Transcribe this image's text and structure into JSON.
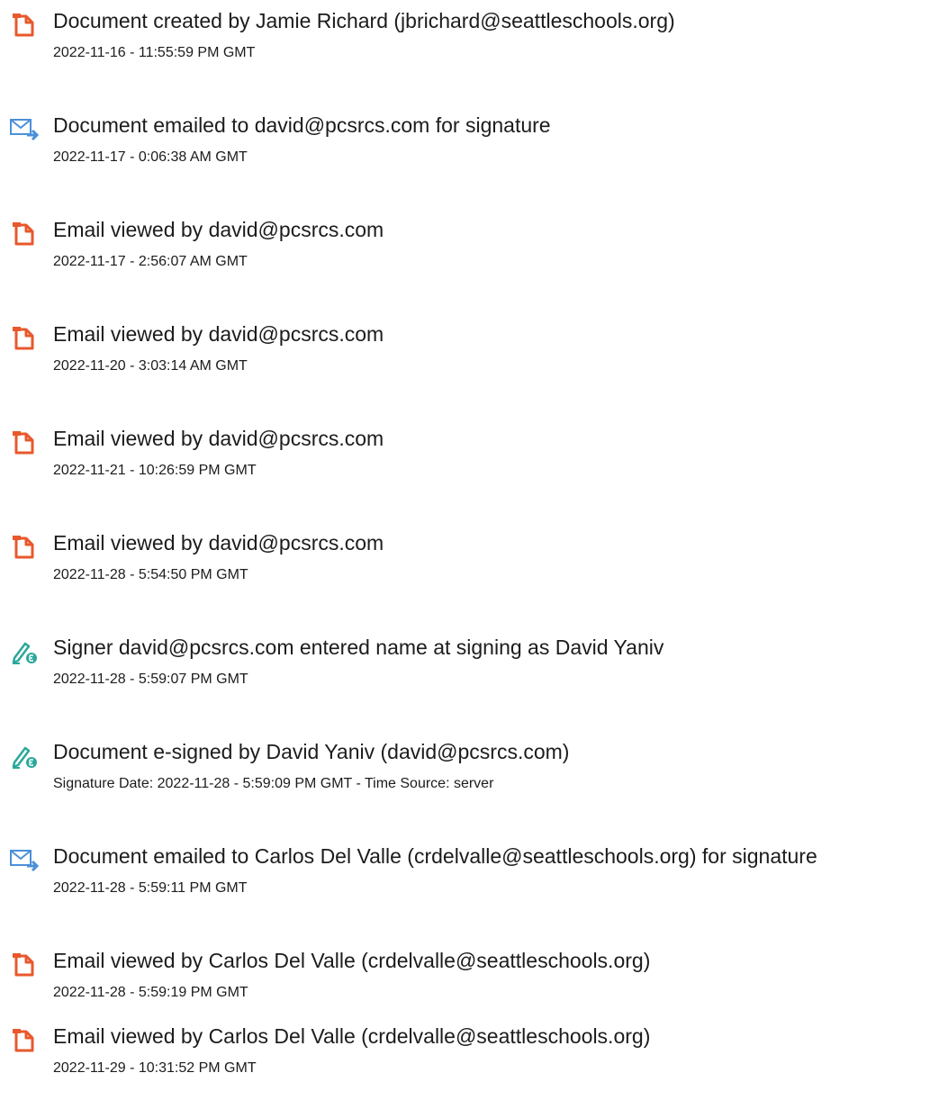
{
  "colors": {
    "doc_icon": "#e8582c",
    "email_icon": "#4a90d9",
    "sign_icon": "#2aa89a",
    "text": "#1c1c1c"
  },
  "events": [
    {
      "icon": "document-icon",
      "title": "Document created by Jamie Richard (jbrichard@seattleschools.org)",
      "meta": "2022-11-16 - 11:55:59 PM GMT"
    },
    {
      "icon": "email-icon",
      "title": "Document emailed to david@pcsrcs.com for signature",
      "meta": "2022-11-17 - 0:06:38 AM GMT"
    },
    {
      "icon": "document-icon",
      "title": "Email viewed by david@pcsrcs.com",
      "meta": "2022-11-17 - 2:56:07 AM GMT"
    },
    {
      "icon": "document-icon",
      "title": "Email viewed by david@pcsrcs.com",
      "meta": "2022-11-20 - 3:03:14 AM GMT"
    },
    {
      "icon": "document-icon",
      "title": "Email viewed by david@pcsrcs.com",
      "meta": "2022-11-21 - 10:26:59 PM GMT"
    },
    {
      "icon": "document-icon",
      "title": "Email viewed by david@pcsrcs.com",
      "meta": "2022-11-28 - 5:54:50 PM GMT"
    },
    {
      "icon": "esign-icon",
      "title": "Signer david@pcsrcs.com entered name at signing as David Yaniv",
      "meta": "2022-11-28 - 5:59:07 PM GMT"
    },
    {
      "icon": "esign-icon",
      "title": "Document e-signed by David Yaniv (david@pcsrcs.com)",
      "meta": "Signature Date: 2022-11-28 - 5:59:09 PM GMT - Time Source: server"
    },
    {
      "icon": "email-icon",
      "title": "Document emailed to Carlos Del Valle (crdelvalle@seattleschools.org) for signature",
      "meta": "2022-11-28 - 5:59:11 PM GMT"
    },
    {
      "icon": "document-icon",
      "title": "Email viewed by Carlos Del Valle (crdelvalle@seattleschools.org)",
      "meta": "2022-11-28 - 5:59:19 PM GMT"
    },
    {
      "icon": "document-icon",
      "title": "Email viewed by Carlos Del Valle (crdelvalle@seattleschools.org)",
      "meta": "2022-11-29 - 10:31:52 PM GMT"
    }
  ]
}
